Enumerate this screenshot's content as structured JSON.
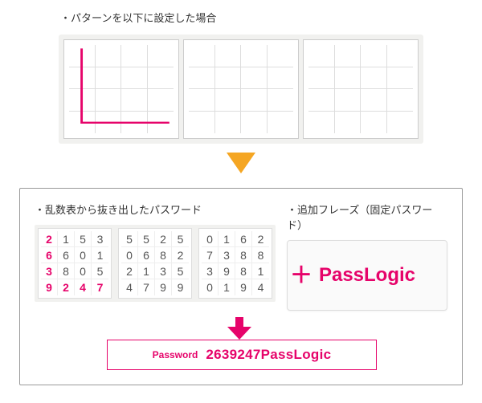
{
  "top": {
    "label": "・パターンを以下に設定した場合",
    "pattern_cells": [
      0,
      4,
      8,
      12,
      13,
      14,
      15
    ]
  },
  "bottom": {
    "left_label": "・乱数表から抜き出したパスワード",
    "right_label": "・追加フレーズ（固定パスワード）",
    "plus": "＋",
    "grids": [
      [
        "2",
        "1",
        "5",
        "3",
        "6",
        "6",
        "0",
        "1",
        "3",
        "8",
        "0",
        "5",
        "9",
        "2",
        "4",
        "7"
      ],
      [
        "5",
        "5",
        "2",
        "5",
        "0",
        "6",
        "8",
        "2",
        "2",
        "1",
        "3",
        "5",
        "4",
        "7",
        "9",
        "9"
      ],
      [
        "0",
        "1",
        "6",
        "2",
        "7",
        "3",
        "8",
        "8",
        "3",
        "9",
        "8",
        "1",
        "0",
        "1",
        "9",
        "4"
      ]
    ],
    "highlight_grid_index": 0,
    "highlight_cells": [
      0,
      4,
      8,
      12,
      13,
      14,
      15
    ],
    "phrase": "PassLogic",
    "result_label": "Password",
    "result_value": "2639247PassLogic"
  }
}
